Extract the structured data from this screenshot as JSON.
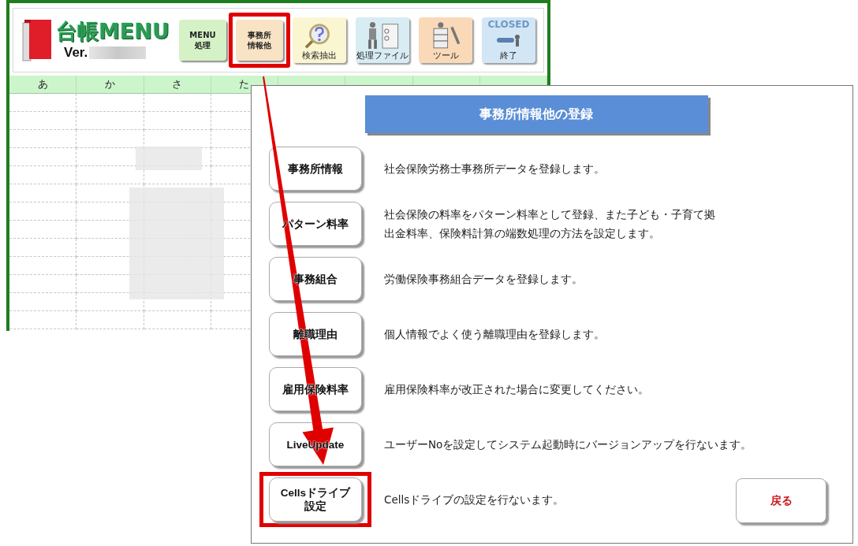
{
  "main_window": {
    "title": "台帳MENU",
    "version_label": "Ver.",
    "toolbar": [
      {
        "kind": "text",
        "lines": [
          "MENU",
          "処理"
        ],
        "highlighted": false
      },
      {
        "kind": "text",
        "lines": [
          "事務所",
          "情報他"
        ],
        "highlighted": true
      },
      {
        "kind": "search",
        "lines": [
          "検索抽出"
        ],
        "highlighted": false
      },
      {
        "kind": "file",
        "lines": [
          "処理ファイル"
        ],
        "highlighted": false
      },
      {
        "kind": "tool",
        "lines": [
          "ツール"
        ],
        "highlighted": false
      },
      {
        "kind": "close",
        "lines": [
          "CLOSED",
          "終了"
        ],
        "highlighted": false
      }
    ],
    "index_tabs": [
      "あ",
      "か",
      "さ",
      "た"
    ]
  },
  "dialog": {
    "title": "事務所情報他の登録",
    "options": [
      {
        "lines": [
          "事務所情報"
        ],
        "description": [
          "社会保険労務士事務所データを登録します。"
        ],
        "highlighted": false
      },
      {
        "lines": [
          "パターン料率"
        ],
        "description": [
          "社会保険の料率をパターン料率として登録、また子ども・子育て拠",
          "出金料率、保険料計算の端数処理の方法を設定します。"
        ],
        "highlighted": false
      },
      {
        "lines": [
          "事務組合"
        ],
        "description": [
          "労働保険事務組合データを登録します。"
        ],
        "highlighted": false
      },
      {
        "lines": [
          "離職理由"
        ],
        "description": [
          "個人情報でよく使う離職理由を登録します。"
        ],
        "highlighted": false
      },
      {
        "lines": [
          "雇用保険料率"
        ],
        "description": [
          "雇用保険料率が改正された場合に変更してください。"
        ],
        "highlighted": false
      },
      {
        "lines": [
          "LiveUpdate"
        ],
        "description": [
          "ユーザーNoを設定してシステム起動時にバージョンアップを行ないます。"
        ],
        "highlighted": false
      },
      {
        "lines": [
          "Cellsドライブ",
          "設定"
        ],
        "description": [
          "Cellsドライブの設定を行ないます。"
        ],
        "highlighted": true
      }
    ],
    "back_button": "戻る"
  }
}
